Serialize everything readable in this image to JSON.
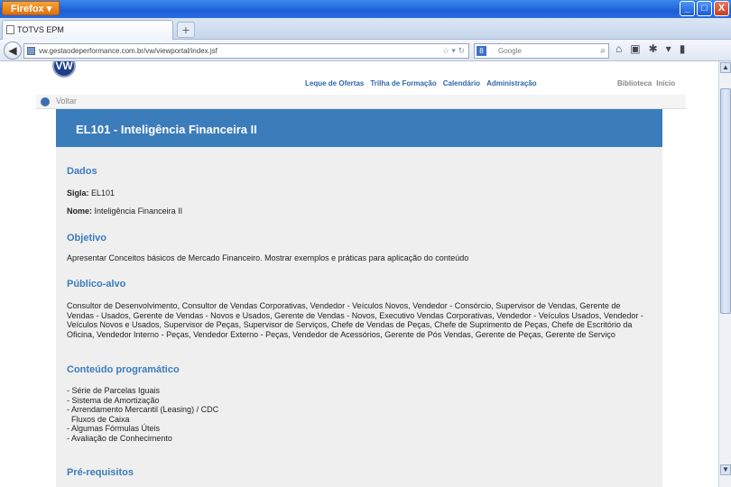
{
  "browser": {
    "menu_label": "Firefox ▾",
    "tab_title": "TOTVS EPM",
    "newtab_label": "+",
    "url": "vw.gestaodeperformance.com.br/vw/viewportal/index.jsf",
    "search_placeholder": "Google",
    "search_engine": "8",
    "window_controls": [
      "_",
      "□",
      "X"
    ]
  },
  "site": {
    "logo_text": "VW",
    "nav": [
      "Leque de Ofertas",
      "Trilha de Formação",
      "Calendário",
      "Administração"
    ],
    "right_nav": [
      "Biblioteca",
      "Início"
    ],
    "back_label": "Voltar"
  },
  "course": {
    "title": "EL101 - Inteligência Financeira II",
    "dados_title": "Dados",
    "sigla_label": "Sigla:",
    "sigla_value": "EL101",
    "nome_label": "Nome:",
    "nome_value": "Inteligência Financeira II",
    "objetivo_title": "Objetivo",
    "objetivo_text": "Apresentar Conceitos básicos de Mercado Financeiro. Mostrar exemplos e práticas para aplicação do conteúdo",
    "publico_title": "Público-alvo",
    "publico_text": "Consultor de Desenvolvimento, Consultor de Vendas Corporativas, Vendedor - Veículos Novos, Vendedor - Consórcio, Supervisor de Vendas, Gerente de Vendas - Usados, Gerente de Vendas - Novos e Usados, Gerente de Vendas - Novos, Executivo Vendas Corporativas, Vendedor - Veículos Usados, Vendedor - Veículos Novos e Usados, Supervisor de Peças, Supervisor de Serviços, Chefe de Vendas de Peças, Chefe de Suprimento de Peças, Chefe de Escritório da Oficina, Vendedor Interno - Peças, Vendedor Externo - Peças, Vendedor de Acessórios, Gerente de Pós Vendas, Gerente de Peças, Gerente de Serviço",
    "conteudo_title": "Conteúdo programático",
    "conteudo_items": [
      "- Série de Parcelas Iguais",
      "- Sistema de Amortização",
      "- Arrendamento Mercantil (Leasing) / CDC",
      "  Fluxos de Caixa",
      "- Algumas Fórmulas Úteis",
      "- Avaliação de Conhecimento"
    ],
    "prereq_title": "Pré-requisitos"
  }
}
